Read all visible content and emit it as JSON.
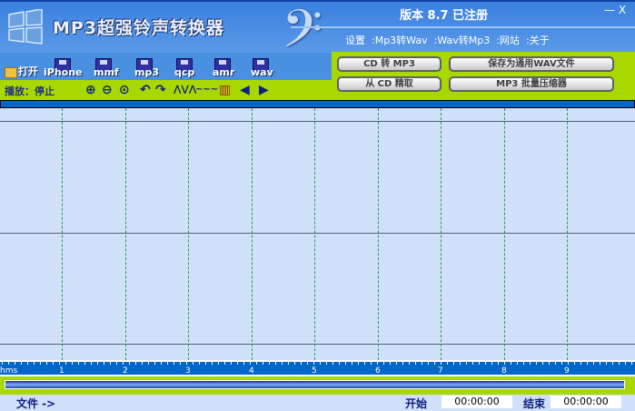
{
  "app": {
    "title": "MP3超强铃声转换器",
    "version": "版本 8.7 已注册",
    "minimize": "—",
    "close": "X"
  },
  "menu": [
    "设置",
    ":Mp3转Wav",
    ":Wav转Mp3",
    ":网站",
    ":关于"
  ],
  "file_buttons": [
    {
      "label": "打开",
      "icon": "folder-icon"
    },
    {
      "label": "iPhone",
      "icon": "disk-icon"
    },
    {
      "label": "mmf",
      "icon": "disk-icon"
    },
    {
      "label": "mp3",
      "icon": "disk-icon"
    },
    {
      "label": "qcp",
      "icon": "disk-icon"
    },
    {
      "label": "amr",
      "icon": "disk-icon"
    },
    {
      "label": "wav",
      "icon": "disk-icon"
    }
  ],
  "playback": {
    "label": "播放：停止"
  },
  "tools": [
    {
      "name": "zoom-in-icon",
      "glyph": "⊕"
    },
    {
      "name": "zoom-out-icon",
      "glyph": "⊖"
    },
    {
      "name": "zoom-fit-icon",
      "glyph": "⊙"
    },
    {
      "name": "undo-icon",
      "glyph": "↶"
    },
    {
      "name": "redo-icon",
      "glyph": "↷"
    },
    {
      "name": "waveform-icon",
      "glyph": "⋀⋁⋀"
    },
    {
      "name": "silence-icon",
      "glyph": "∼∼∼"
    },
    {
      "name": "normalize-icon",
      "glyph": "▥"
    },
    {
      "name": "fade-in-icon",
      "glyph": "◀"
    },
    {
      "name": "fade-out-icon",
      "glyph": "▶"
    }
  ],
  "actions": {
    "cd_to_mp3": "CD  转  MP3",
    "save_wav": "保存为通用WAV文件",
    "rip_cd": "从 CD 精取",
    "mp3_batch": "MP3 批量压缩器"
  },
  "ruler": {
    "unit": "hms",
    "labels": [
      "1",
      "2",
      "3",
      "4",
      "5",
      "6",
      "7",
      "8",
      "9"
    ]
  },
  "status": {
    "file_label": "文件 ->",
    "start_label": "开始",
    "start_value": "00:00:00",
    "end_label": "结束",
    "end_value": "00:00:00"
  }
}
